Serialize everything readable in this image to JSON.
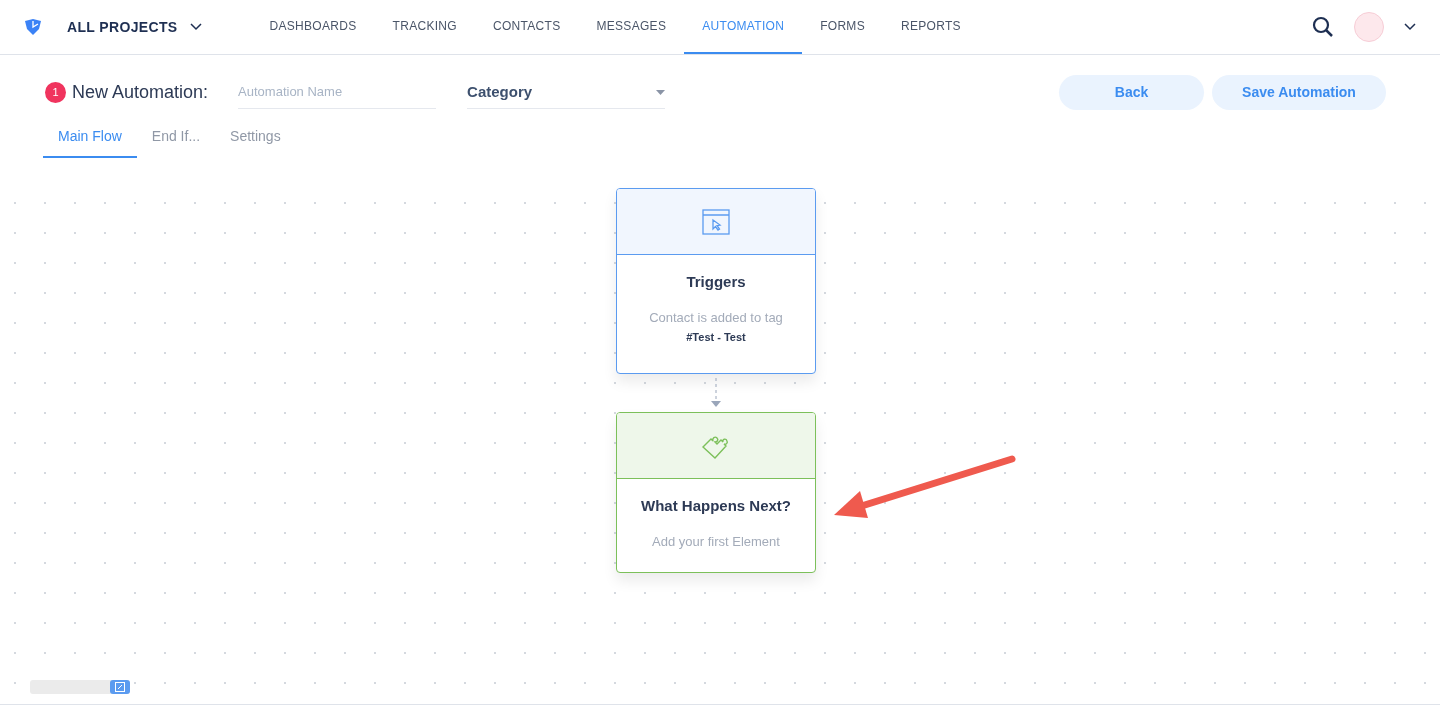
{
  "nav": {
    "project": "ALL PROJECTS",
    "items": [
      {
        "label": "DASHBOARDS",
        "selected": false
      },
      {
        "label": "TRACKING",
        "selected": false
      },
      {
        "label": "CONTACTS",
        "selected": false
      },
      {
        "label": "MESSAGES",
        "selected": false
      },
      {
        "label": "AUTOMATION",
        "selected": true
      },
      {
        "label": "FORMS",
        "selected": false
      },
      {
        "label": "REPORTS",
        "selected": false
      }
    ]
  },
  "header": {
    "step": "1",
    "title": "New Automation:",
    "name_placeholder": "Automation Name",
    "category": "Category",
    "buttons": [
      "Back",
      "Save Automation"
    ]
  },
  "tabs": [
    {
      "label": "Main Flow",
      "selected": true
    },
    {
      "label": "End If...",
      "selected": false
    },
    {
      "label": "Settings",
      "selected": false
    }
  ],
  "nodes": [
    {
      "kind": "trigger",
      "title": "Triggers",
      "text": "Contact is added to tag",
      "detail": "#Test - Test"
    },
    {
      "kind": "placeholder",
      "title": "What Happens Next?",
      "text": "Add your first Element"
    }
  ],
  "zoom": {
    "level": 1
  }
}
